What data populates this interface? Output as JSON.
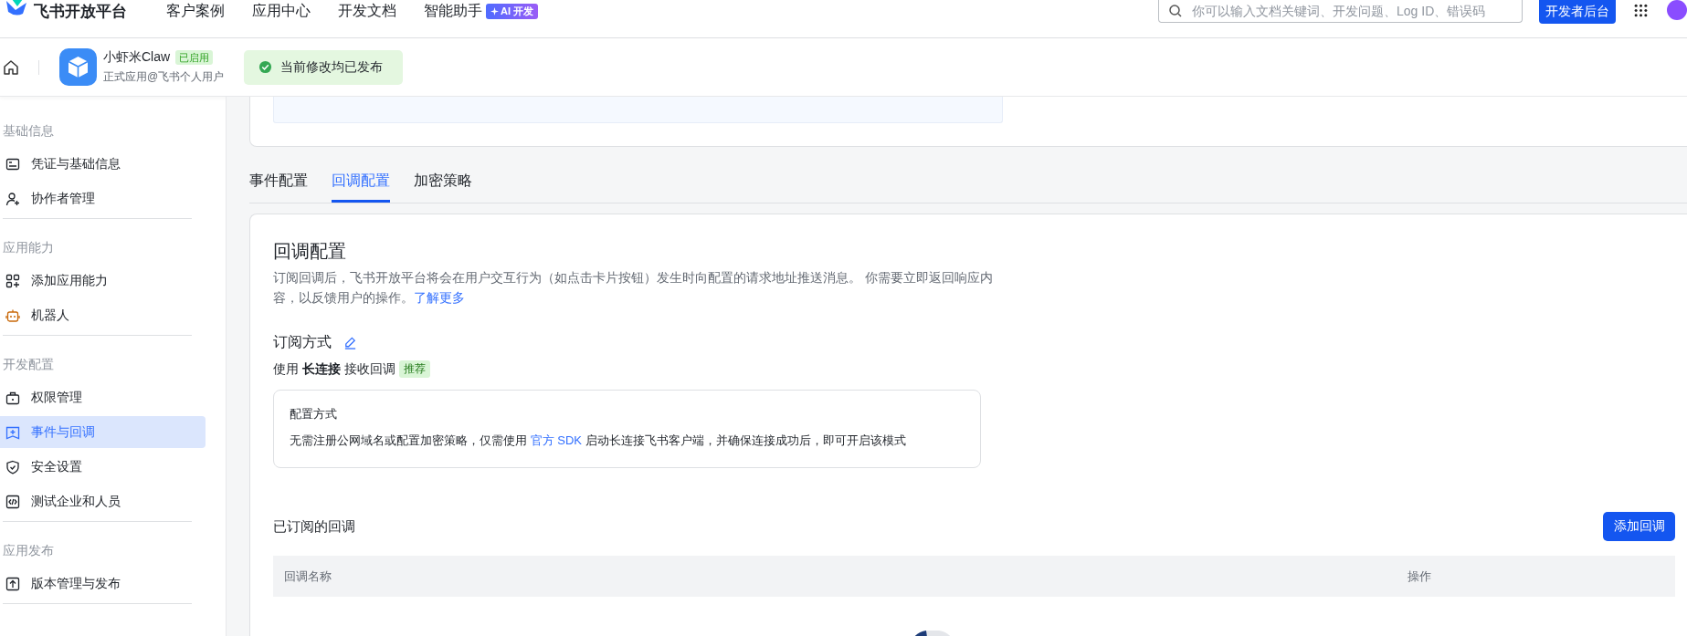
{
  "brand": {
    "name": "飞书开放平台"
  },
  "nav": [
    {
      "label": "客户案例"
    },
    {
      "label": "应用中心"
    },
    {
      "label": "开发文档"
    },
    {
      "label": "智能助手",
      "badge": "AI 开发"
    }
  ],
  "search": {
    "placeholder": "你可以输入文档关键词、开发问题、Log ID、错误码"
  },
  "console_button": "开发者后台",
  "app": {
    "name": "小虾米Claw",
    "status": "已启用",
    "subtitle": "正式应用@飞书个人用户"
  },
  "toast": {
    "text": "当前修改均已发布"
  },
  "sidebar": {
    "groups": [
      {
        "title": "基础信息",
        "items": [
          {
            "label": "凭证与基础信息",
            "kind": "credential",
            "selected": false
          },
          {
            "label": "协作者管理",
            "kind": "collaborator",
            "selected": false
          }
        ]
      },
      {
        "title": "应用能力",
        "items": [
          {
            "label": "添加应用能力",
            "kind": "ability",
            "selected": false
          },
          {
            "label": "机器人",
            "kind": "robot",
            "selected": false
          }
        ]
      },
      {
        "title": "开发配置",
        "items": [
          {
            "label": "权限管理",
            "kind": "permission",
            "selected": false
          },
          {
            "label": "事件与回调",
            "kind": "event",
            "selected": true
          },
          {
            "label": "安全设置",
            "kind": "security",
            "selected": false
          },
          {
            "label": "测试企业和人员",
            "kind": "test",
            "selected": false
          }
        ]
      },
      {
        "title": "应用发布",
        "items": [
          {
            "label": "版本管理与发布",
            "kind": "release",
            "selected": false
          }
        ]
      }
    ]
  },
  "tabs": [
    {
      "label": "事件配置",
      "selected": false
    },
    {
      "label": "回调配置",
      "selected": true
    },
    {
      "label": "加密策略",
      "selected": false
    }
  ],
  "callback": {
    "title": "回调配置",
    "description": "订阅回调后，飞书开放平台将会在用户交互行为（如点击卡片按钮）发生时向配置的请求地址推送消息。 你需要立即返回响应内容，以反馈用户的操作。",
    "link": "了解更多",
    "subscription": {
      "title": "订阅方式",
      "mode_text": "使用 **长连接** 接收回调",
      "tag": "推荐",
      "box_title": "配置方式",
      "box_text_before": "无需注册公网域名或配置加密策略，仅需使用 ",
      "box_link": "官方 SDK",
      "box_text_after": " 启动长连接飞书客户端，并确保连接成功后，即可开启该模式"
    }
  },
  "subscribed": {
    "title": "已订阅的回调",
    "add_button": "添加回调",
    "columns": [
      "回调名称",
      "操作"
    ]
  }
}
